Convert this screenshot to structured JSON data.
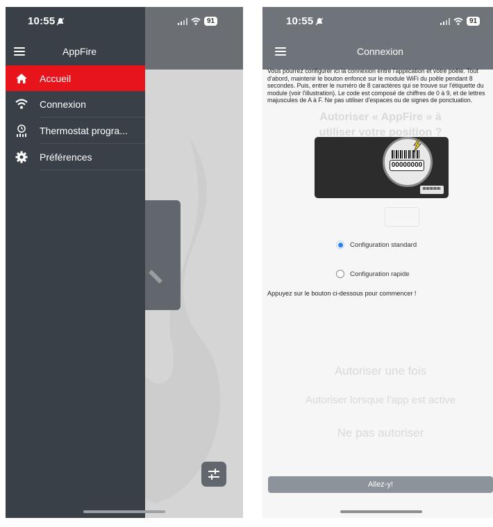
{
  "left_phone": {
    "status": {
      "time": "10:55",
      "battery": "91"
    },
    "nav_title": "AppFire",
    "drawer_items": [
      {
        "label": "Accueil",
        "icon": "home-icon",
        "active": true
      },
      {
        "label": "Connexion",
        "icon": "wifi-icon",
        "active": false
      },
      {
        "label": "Thermostat progra...",
        "icon": "thermostat-icon",
        "active": false
      },
      {
        "label": "Préférences",
        "icon": "gear-icon",
        "active": false
      }
    ],
    "active_color": "#e8141b",
    "drawer_color": "#3a4047"
  },
  "right_phone": {
    "status": {
      "time": "10:55",
      "battery": "91"
    },
    "nav_title": "Connexion",
    "intro_text": "Vous pourrez configurer ici la connexion entre l'application et votre poêle. Tout d'abord, maintenir le bouton enfoncé sur le module WiFi du poêle pendant 8 secondes. Puis, entrer le numéro de 8 caractères qui se trouve sur l'étiquette du module (voir l'illustration). Le code est composé de chiffres de 0 à 9, et de lettres majuscules de A à F. Ne pas utiliser d'espaces ou de signes de ponctuation.",
    "illustration_code": "00000000",
    "options": [
      {
        "label": "Configuration standard",
        "selected": true
      },
      {
        "label": "Configuration rapide",
        "selected": false
      }
    ],
    "hint_text": "Appuyez sur le bouton ci-dessous pour commencer !",
    "cta_label": "Allez-y!",
    "ghost": {
      "title_line1": "Autoriser « AppFire » à",
      "title_line2": "utiliser votre position ?",
      "allow_once": "Autoriser une fois",
      "allow_while_using": "Autoriser lorsque l'app est active",
      "dont_allow": "Ne pas autoriser"
    },
    "accent_color": "#2f7ef6"
  }
}
